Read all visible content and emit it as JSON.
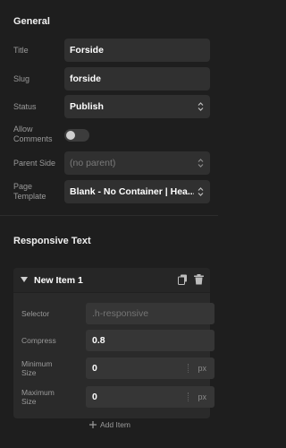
{
  "general": {
    "title": "General",
    "fields": {
      "title": {
        "label": "Title",
        "value": "Forside"
      },
      "slug": {
        "label": "Slug",
        "value": "forside"
      },
      "status": {
        "label": "Status",
        "value": "Publish"
      },
      "allow_comments": {
        "label_line1": "Allow",
        "label_line2": "Comments",
        "enabled": false
      },
      "parent_side": {
        "label": "Parent Side",
        "placeholder": "(no parent)"
      },
      "page_template": {
        "label_line1": "Page",
        "label_line2": "Template",
        "value": "Blank - No Container | Hea..."
      }
    }
  },
  "responsive_text": {
    "title": "Responsive Text",
    "item": {
      "title": "New Item 1",
      "selector": {
        "label": "Selector",
        "placeholder": ".h-responsive"
      },
      "compress": {
        "label": "Compress",
        "value": "0.8"
      },
      "minimum_size": {
        "label_line1": "Minimum",
        "label_line2": "Size",
        "value": "0",
        "unit": "px"
      },
      "maximum_size": {
        "label_line1": "Maximum",
        "label_line2": "Size",
        "value": "0",
        "unit": "px"
      }
    },
    "add_item_label": "Add Item"
  }
}
